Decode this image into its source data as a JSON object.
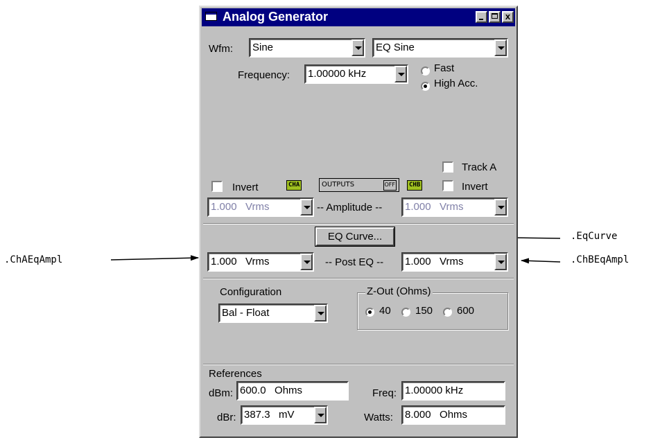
{
  "window": {
    "title": "Analog Generator",
    "close_glyph": "x"
  },
  "waveform": {
    "label": "Wfm:",
    "type_value": "Sine",
    "variant_value": "EQ Sine"
  },
  "frequency": {
    "label": "Frequency:",
    "value": "1.00000 kHz",
    "mode_fast": "Fast",
    "mode_high_acc": "High Acc.",
    "selected_mode": "High Acc."
  },
  "outputs": {
    "track_a_label": "Track A",
    "invert_a_label": "Invert",
    "invert_b_label": "Invert",
    "cha_chip": "CHA",
    "chb_chip": "CHB",
    "outputs_label": "OUTPUTS",
    "outputs_state": "OFF"
  },
  "amplitude": {
    "label": "-- Amplitude --",
    "cha_value": "1.000   Vrms",
    "chb_value": "1.000   Vrms"
  },
  "eq": {
    "button_label": "EQ Curve...",
    "post_eq_label": "-- Post EQ --",
    "cha_value": "1.000   Vrms",
    "chb_value": "1.000   Vrms"
  },
  "configuration": {
    "label": "Configuration",
    "value": "Bal - Float"
  },
  "zout": {
    "label": "Z-Out (Ohms)",
    "options": [
      "40",
      "150",
      "600"
    ],
    "selected": "40"
  },
  "references": {
    "label": "References",
    "dbm_label": "dBm:",
    "dbm_value": "600.0   Ohms",
    "dbr_label": "dBr:",
    "dbr_value": "387.3   mV",
    "freq_label": "Freq:",
    "freq_value": "1.00000 kHz",
    "watts_label": "Watts:",
    "watts_value": "8.000   Ohms"
  },
  "annotations": {
    "left": ".ChAEqAmpl",
    "eq_curve": ".EqCurve",
    "right": ".ChBEqAmpl"
  }
}
